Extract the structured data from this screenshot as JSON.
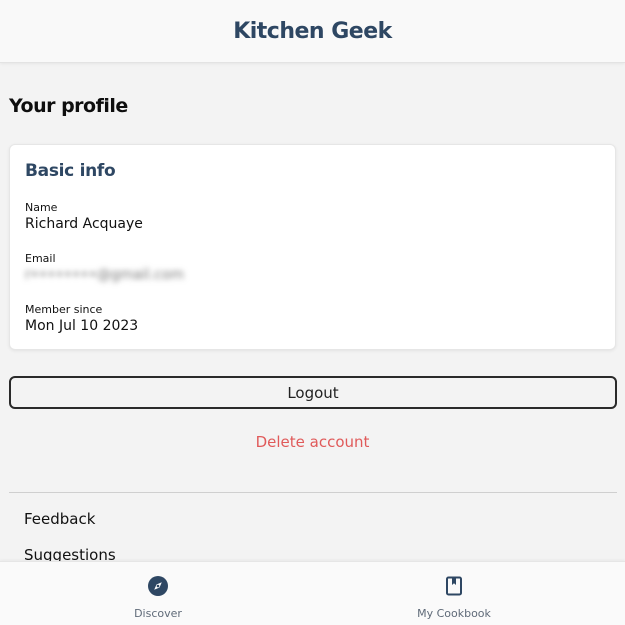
{
  "header": {
    "title": "Kitchen Geek"
  },
  "page": {
    "heading": "Your profile"
  },
  "basic_info": {
    "title": "Basic info",
    "name_label": "Name",
    "name_value": "Richard Acquaye",
    "email_label": "Email",
    "email_value": "r••••••••@gmail.com",
    "member_since_label": "Member since",
    "member_since_value": "Mon Jul 10 2023"
  },
  "actions": {
    "logout_label": "Logout",
    "delete_account_label": "Delete account"
  },
  "links": {
    "feedback_label": "Feedback",
    "suggestions_label": "Suggestions"
  },
  "bottom_nav": {
    "items": [
      {
        "label": "Discover",
        "icon": "compass-icon"
      },
      {
        "label": "My Cookbook",
        "icon": "bookmark-book-icon"
      }
    ]
  },
  "colors": {
    "brand": "#2e4763",
    "danger": "#e05a5a",
    "background": "#f3f3f3"
  }
}
